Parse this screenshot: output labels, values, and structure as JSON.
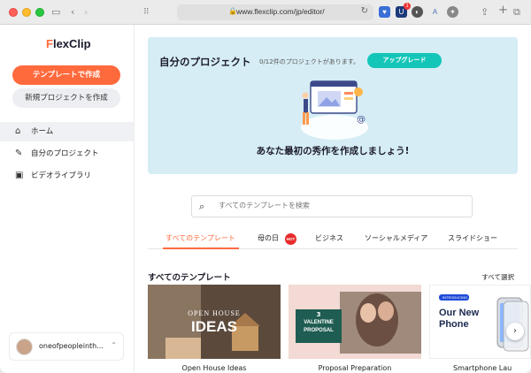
{
  "browser": {
    "url": "www.flexclip.com/jp/editor/",
    "extension_badge": "1"
  },
  "sidebar": {
    "logo": {
      "mark": "F",
      "text": "lexClip"
    },
    "create_from_template": "テンプレートで作成",
    "new_project": "新規プロジェクトを作成",
    "nav": [
      {
        "label": "ホーム",
        "icon": "home-icon",
        "active": true
      },
      {
        "label": "自分のプロジェクト",
        "icon": "edit-document-icon",
        "active": false
      },
      {
        "label": "ビデオライブラリ",
        "icon": "video-library-icon",
        "active": false
      }
    ],
    "user": {
      "name": "oneofpeopleinth..."
    }
  },
  "banner": {
    "title": "自分のプロジェクト",
    "count": "0/12件のプロジェクトがあります。",
    "upgrade": "アップグレード",
    "cta": "あなた最初の秀作を作成しましょう!"
  },
  "search": {
    "placeholder": "すべてのテンプレートを検索"
  },
  "tabs": [
    {
      "label": "すべてのテンプレート",
      "active": true
    },
    {
      "label": "母の日",
      "active": false,
      "badge": "HOT"
    },
    {
      "label": "ビジネス",
      "active": false
    },
    {
      "label": "ソーシャルメディア",
      "active": false
    },
    {
      "label": "スライドショー",
      "active": false
    }
  ],
  "templates": {
    "title": "すべてのテンプレート",
    "see_all": "すべて選択",
    "items": [
      {
        "caption": "Open House Ideas",
        "line1": "OPEN HOUSE",
        "line2": "IDEAS"
      },
      {
        "caption": "Proposal Preparation",
        "line1": "3",
        "line2": "VALENTINE",
        "line3": "PROPOSAL"
      },
      {
        "caption": "Smartphone Lau",
        "tag": "INTRODUCING",
        "line1": "Our New",
        "line2": "Phone"
      }
    ]
  },
  "colors": {
    "accent": "#ff6a3d",
    "banner_bg": "#d6edf5",
    "upgrade": "#14c6b8"
  }
}
